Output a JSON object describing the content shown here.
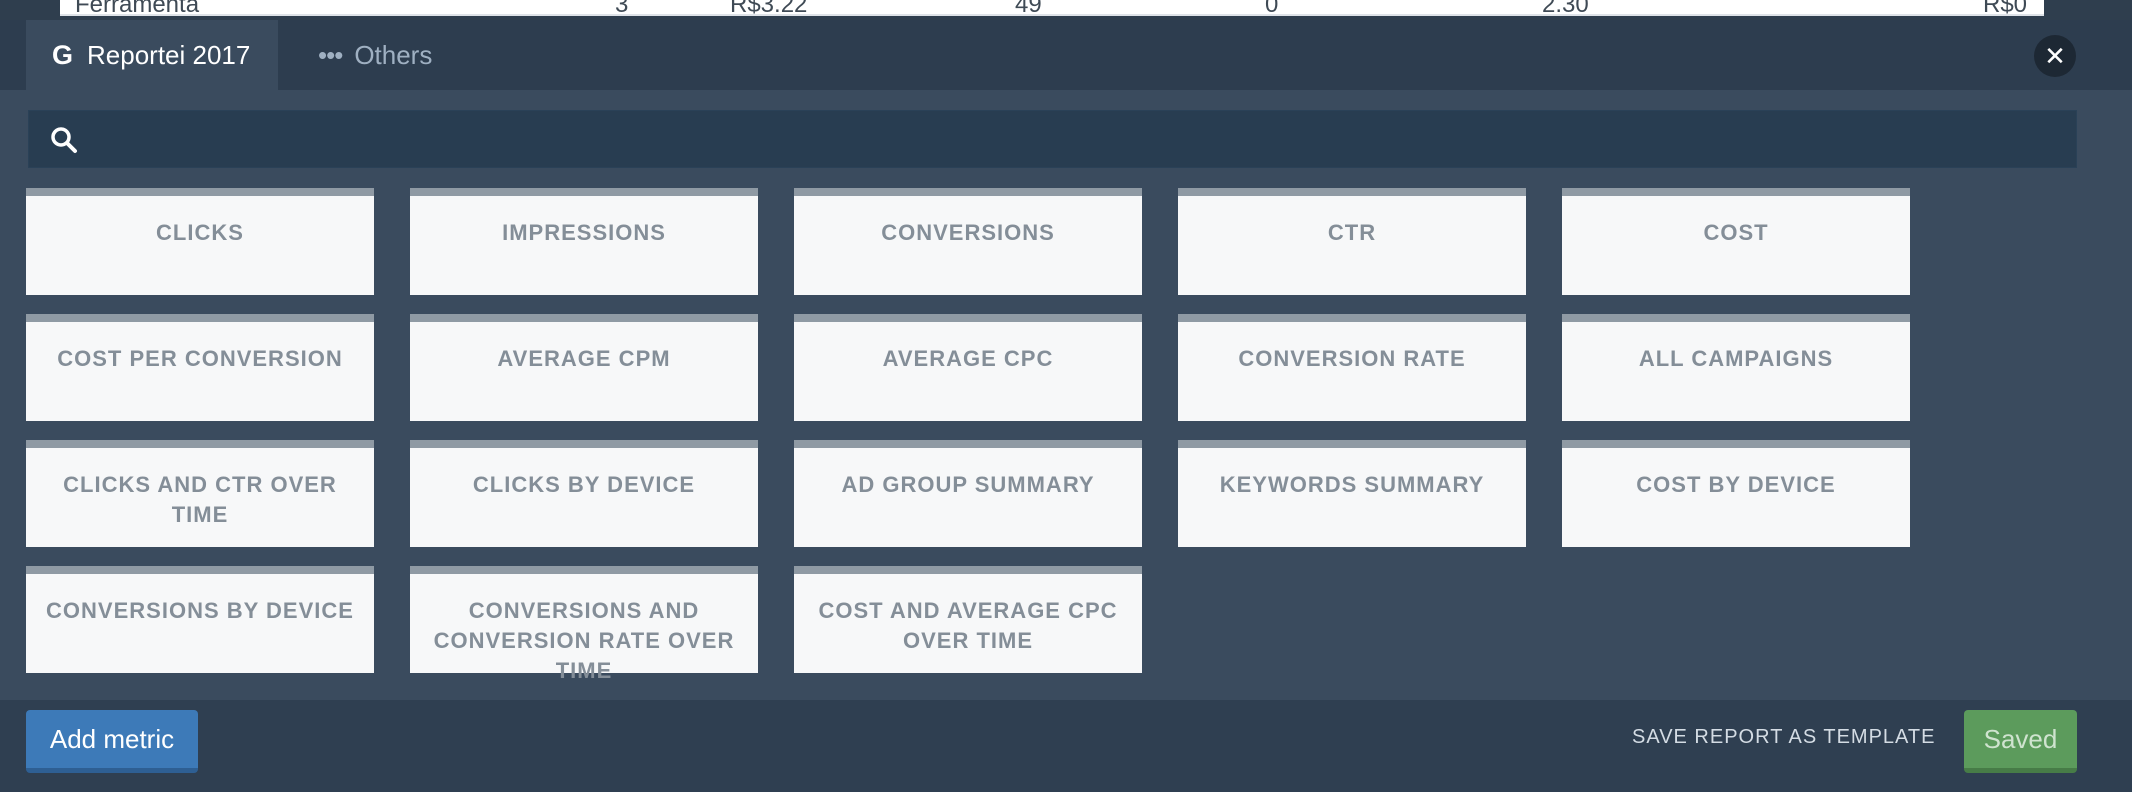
{
  "background_row": {
    "name": "Ferramenta",
    "col1": "3",
    "col2": "R$3.22",
    "col3": "49",
    "col4": "0",
    "col5": "2.30",
    "col6": "R$0"
  },
  "tabs": [
    {
      "label": "Reportei 2017",
      "icon": "google-g-icon"
    },
    {
      "label": "Others",
      "icon": "ellipsis-icon"
    }
  ],
  "search": {
    "placeholder": "",
    "value": ""
  },
  "metrics": [
    "CLICKS",
    "IMPRESSIONS",
    "CONVERSIONS",
    "CTR",
    "COST",
    "COST PER CONVERSION",
    "AVERAGE CPM",
    "AVERAGE CPC",
    "CONVERSION RATE",
    "ALL CAMPAIGNS",
    "CLICKS AND CTR OVER TIME",
    "CLICKS BY DEVICE",
    "AD GROUP SUMMARY",
    "KEYWORDS SUMMARY",
    "COST BY DEVICE",
    "CONVERSIONS BY DEVICE",
    "CONVERSIONS AND CONVERSION RATE OVER TIME",
    "COST AND AVERAGE CPC OVER TIME"
  ],
  "footer": {
    "add_metric_label": "Add metric",
    "save_template_label": "SAVE REPORT AS TEMPLATE",
    "saved_label": "Saved"
  },
  "colors": {
    "primary_button": "#3d7ab8",
    "success_button": "#5c9b5c",
    "modal_bg": "#3a4b5e"
  }
}
